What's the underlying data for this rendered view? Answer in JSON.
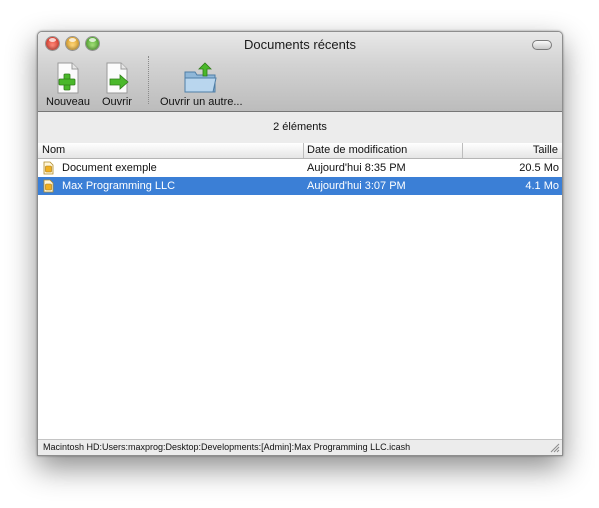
{
  "window": {
    "title": "Documents récents"
  },
  "toolbar": {
    "new_label": "Nouveau",
    "open_label": "Ouvrir",
    "open_other_label": "Ouvrir un autre..."
  },
  "list": {
    "item_count": "2 éléments",
    "columns": [
      "Nom",
      "Date de modification",
      "Taille"
    ],
    "rows": [
      {
        "name": "Document exemple",
        "modified": "Aujourd'hui 8:35 PM",
        "size": "20.5 Mo",
        "selected": false
      },
      {
        "name": "Max Programming LLC",
        "modified": "Aujourd'hui 3:07 PM",
        "size": "4.1 Mo",
        "selected": true
      }
    ]
  },
  "status": {
    "path": "Macintosh HD:Users:maxprog:Desktop:Developments:[Admin]:Max Programming LLC.icash"
  },
  "colors": {
    "selection": "#3b7fd6",
    "close": "#d0281a",
    "minimize": "#d4941a",
    "zoom": "#3d9a1e",
    "icon_accent": "#4ab82a"
  },
  "icons": {
    "new": "document-plus-icon",
    "open": "document-arrow-icon",
    "open_other": "folder-up-arrow-icon",
    "row": "cash-document-icon"
  }
}
